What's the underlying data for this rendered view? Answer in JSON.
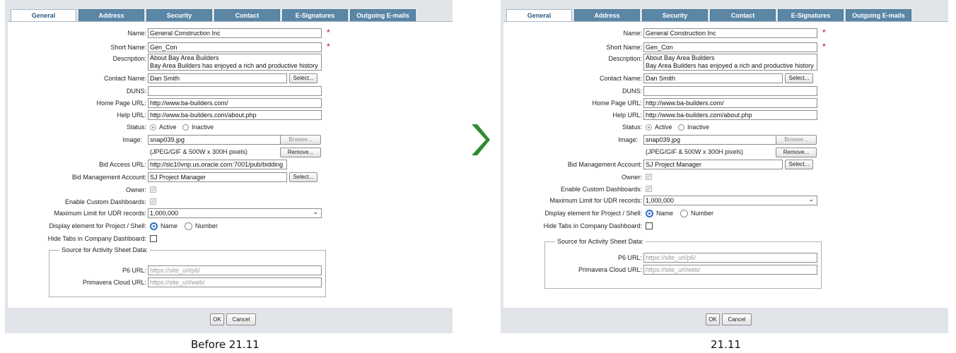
{
  "tabs": [
    "General",
    "Address",
    "Security",
    "Contact",
    "E-Signatures",
    "Outgoing E-mails"
  ],
  "form": {
    "name_label": "Name:",
    "name_value": "General Construction Inc",
    "short_name_label": "Short Name:",
    "short_name_value": "Gen_Con",
    "description_label": "Description:",
    "description_line1": "About Bay Area Builders",
    "description_line2": "Bay Area Builders has enjoyed a rich and productive history",
    "contact_name_label": "Contact Name:",
    "contact_name_value": "Dan Smith",
    "select_label": "Select...",
    "duns_label": "DUNS:",
    "duns_value": "",
    "home_url_label": "Home Page URL:",
    "home_url_value": "http://www.ba-builders.com/",
    "help_url_label": "Help URL:",
    "help_url_value": "http://www.ba-builders.com/about.php",
    "status_label": "Status:",
    "status_active": "Active",
    "status_inactive": "Inactive",
    "image_label": "Image:",
    "image_value": "snap039.jpg",
    "browse_label": "Browse...",
    "image_hint": "(JPEG/GIF & 500W x 300H pixels)",
    "remove_label": "Remove...",
    "bid_url_label": "Bid Access URL:",
    "bid_url_value": "http://slc10vnp.us.oracle.com:7001/pub/bidding",
    "bid_account_label": "Bid Management Account:",
    "bid_account_value": "SJ Project Manager",
    "owner_label": "Owner:",
    "custom_dash_label": "Enable Custom Dashboards:",
    "udr_label": "Maximum Limit for UDR records:",
    "udr_value": "1,000,000",
    "display_label": "Display element for Project / Shell:",
    "display_name": "Name",
    "display_number": "Number",
    "hide_tabs_label": "Hide Tabs in Company Dashboard:",
    "activity_legend": "Source for Activity Sheet Data:",
    "p6_label": "P6 URL:",
    "p6_placeholder": "https://site_url/p6/",
    "primavera_label": "Primavera Cloud URL:",
    "primavera_placeholder": "https://site_url/web/",
    "required_mark": "*",
    "check_mark": "✓",
    "dropdown_chevron": "⌄"
  },
  "buttons": {
    "ok": "OK",
    "cancel": "Cancel"
  },
  "captions": {
    "before": "Before 21.11",
    "after": "21.11"
  },
  "colors": {
    "tab_blue": "#5b86a6",
    "arrow_green": "#2e8b2e",
    "required_red": "#d00000"
  }
}
